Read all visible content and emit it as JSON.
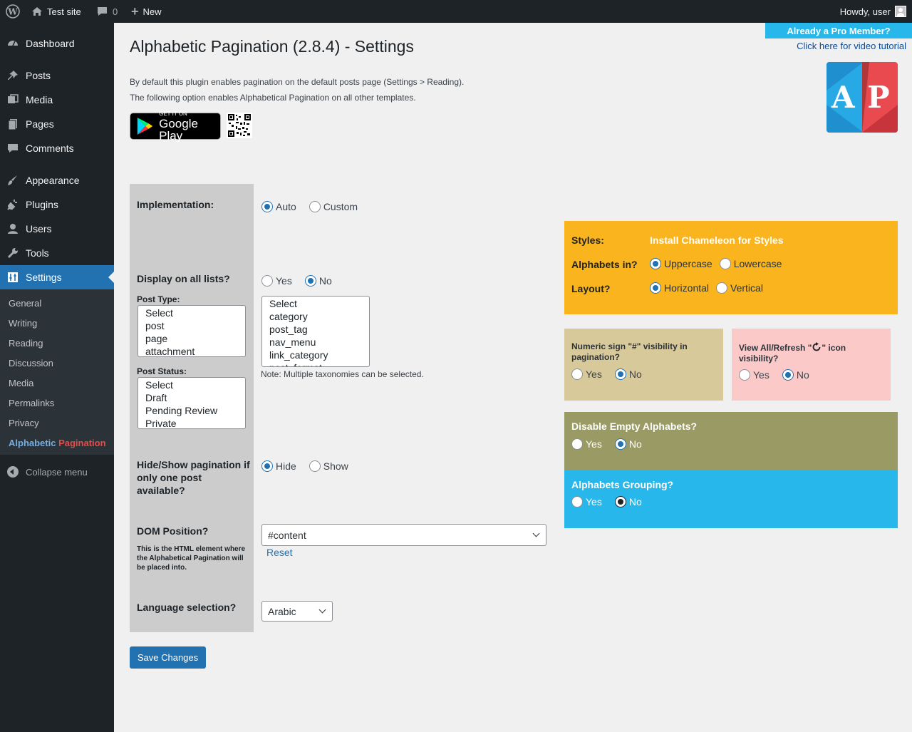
{
  "adminbar": {
    "site_name": "Test site",
    "comments_count": "0",
    "new_label": "New",
    "howdy": "Howdy, user"
  },
  "sidebar": {
    "items": [
      {
        "label": "Dashboard",
        "icon": "dashboard-icon"
      },
      {
        "label": "Posts",
        "icon": "pin-icon"
      },
      {
        "label": "Media",
        "icon": "media-icon"
      },
      {
        "label": "Pages",
        "icon": "pages-icon"
      },
      {
        "label": "Comments",
        "icon": "comments-icon"
      },
      {
        "label": "Appearance",
        "icon": "brush-icon"
      },
      {
        "label": "Plugins",
        "icon": "plug-icon"
      },
      {
        "label": "Users",
        "icon": "user-icon"
      },
      {
        "label": "Tools",
        "icon": "wrench-icon"
      },
      {
        "label": "Settings",
        "icon": "settings-icon"
      }
    ],
    "submenu": [
      "General",
      "Writing",
      "Reading",
      "Discussion",
      "Media",
      "Permalinks",
      "Privacy"
    ],
    "plugin_item": {
      "part1": "Alphabetic",
      "part2": "Pagination"
    },
    "collapse_label": "Collapse menu"
  },
  "page": {
    "title": "Alphabetic Pagination (2.8.4) - Settings",
    "intro_1": "By default this plugin enables pagination on the default posts page (Settings > Reading).",
    "intro_2": "The following option enables Alphabetical Pagination on all other templates.",
    "pro_label": "Already a Pro Member?",
    "video_link": "Click here for video tutorial",
    "gplay_small": "GET IT ON",
    "gplay_big": "Google Play",
    "logo_letters": {
      "left": "A",
      "right": "P"
    }
  },
  "form": {
    "implementation": {
      "label": "Implementation:",
      "options": [
        "Auto",
        "Custom"
      ],
      "selected": "Auto"
    },
    "display_all": {
      "label": "Display on all lists?",
      "options": [
        "Yes",
        "No"
      ],
      "selected": "No"
    },
    "post_type": {
      "label": "Post Type:",
      "options": [
        "Select",
        "post",
        "page",
        "attachment"
      ]
    },
    "taxonomies": {
      "options": [
        "Select",
        "category",
        "post_tag",
        "nav_menu",
        "link_category",
        "post_format"
      ],
      "note": "Note: Multiple taxonomies can be selected."
    },
    "post_status": {
      "label": "Post Status:",
      "options": [
        "Select",
        "Draft",
        "Pending Review",
        "Private"
      ]
    },
    "hide_show": {
      "label": "Hide/Show pagination if only one post available?",
      "options": [
        "Hide",
        "Show"
      ],
      "selected": "Hide"
    },
    "dom_position": {
      "label": "DOM Position?",
      "help": "This is the HTML element where the Alphabetical Pagination will be placed into.",
      "value": "#content",
      "reset": "Reset"
    },
    "language": {
      "label": "Language selection?",
      "value": "Arabic"
    },
    "save_label": "Save Changes"
  },
  "panels": {
    "styles_label": "Styles:",
    "styles_value": "Install Chameleon for Styles",
    "alphabets_label": "Alphabets in?",
    "alphabets_options": [
      "Uppercase",
      "Lowercase"
    ],
    "layout_label": "Layout?",
    "layout_options": [
      "Horizontal",
      "Vertical"
    ],
    "numeric_label": "Numeric sign \"#\" visibility in pagination?",
    "viewall_label_a": "View All/Refresh \"",
    "viewall_label_b": "\" icon visibility?",
    "disable_label": "Disable Empty Alphabets?",
    "grouping_label": "Alphabets Grouping?",
    "yes": "Yes",
    "no": "No"
  },
  "colors": {
    "styles_panel": "#f9b41e",
    "numeric_panel": "#d8c99b",
    "viewall_panel": "#fcc9c9",
    "disable_panel": "#9a9a64",
    "grouping_panel": "#27b7ea",
    "accent": "#2271b1"
  }
}
